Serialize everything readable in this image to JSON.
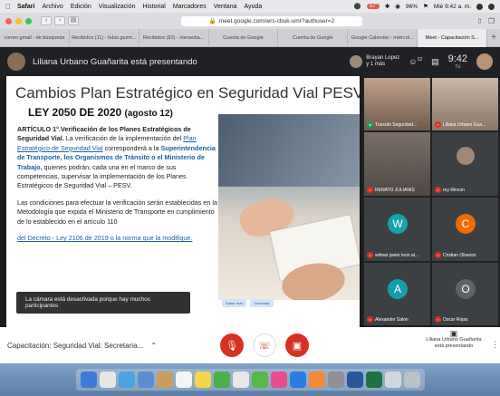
{
  "menubar": {
    "items": [
      "Safari",
      "Archivo",
      "Edición",
      "Visualización",
      "Historial",
      "Marcadores",
      "Ventana",
      "Ayuda"
    ],
    "battery": "96%",
    "rec": "57'",
    "datetime": "Mié 9:42 a. m."
  },
  "toolbar": {
    "url": "meet.google.com/wrs-cbuk-umr?authuser=2"
  },
  "tabs": [
    "correo gmail - de búsqueda",
    "Recibidos (11) - fabio.guzm...",
    "Recibidos (82) - riienavba...",
    "Cuenta de Google",
    "Cuenta de Google",
    "Google Calendar - miércol...",
    "Meet - Capacitación S..."
  ],
  "meet": {
    "presenting_text": "Liliana Urbano Guañarita está presentando",
    "presenter_chip_name": "Brayan Lopez",
    "presenter_chip_sub": "y 1 más",
    "participant_count": "12",
    "time": "9:42",
    "time_sub": "Tú"
  },
  "slide": {
    "title": "Cambios Plan Estratégico en Seguridad Vial PESV –",
    "subtitle_main": "LEY 2050 DE 2020",
    "subtitle_date": "(agosto 12)",
    "p1_bold": "ARTÍCULO 1°.Verificación de los Planes Estratégicos de Seguridad Vial.",
    "p1_text1": " La verificación de la implementación del ",
    "p1_link": "Plan Estratégico de Seguridad Vial",
    "p1_text2": " corresponderá a la ",
    "p1_blue": "Superintendencia de Transporte, los Organismos de Tránsito o el Ministerio de Trabajo,",
    "p1_text3": " quienes podrán, cada una en el marco de sus competencias, supervisar la implementación de los Planes Estratégicos de Seguridad Vial – PESV.",
    "p2_text": "Las condiciones para efectuar la verificación serán establecidas en la Metodología que expida el Ministerio de Transporte en cumplimiento de lo establecido en el artículo 110",
    "p3_text": "del Decreto - Ley 2106 de 2019 o la norma que la modifique.",
    "toast": "La cámara está desactivada porque hay muchos participantes",
    "mini_btn1": "Saber más",
    "mini_btn2": "Descartar"
  },
  "participants": [
    {
      "name": "Transito Seguridad...",
      "letter": "",
      "color": ""
    },
    {
      "name": "Liliana Urbano Gua...",
      "letter": "",
      "color": ""
    },
    {
      "name": "RENATO JULIANIS",
      "letter": "",
      "color": ""
    },
    {
      "name": "rey Rincon",
      "letter": "",
      "color": ""
    },
    {
      "name": "wilmar javier leon al...",
      "letter": "W",
      "color": "#12a4af"
    },
    {
      "name": "Cristian Oliveros",
      "letter": "C",
      "color": "#ef6c00"
    },
    {
      "name": "Alexander Salon",
      "letter": "A",
      "color": "#129eaf"
    },
    {
      "name": "Oscar Rojas",
      "letter": "O",
      "color": "#5f6368"
    }
  ],
  "bottombar": {
    "meeting_name": "Capacitación: Seguridad Vial: Secretaria...",
    "presenter_info": "Liliana Urbano Guañarita está presentando"
  },
  "colors": {
    "accent_red": "#d93025",
    "meet_dark": "#202124",
    "link_blue": "#1b5fa8"
  }
}
